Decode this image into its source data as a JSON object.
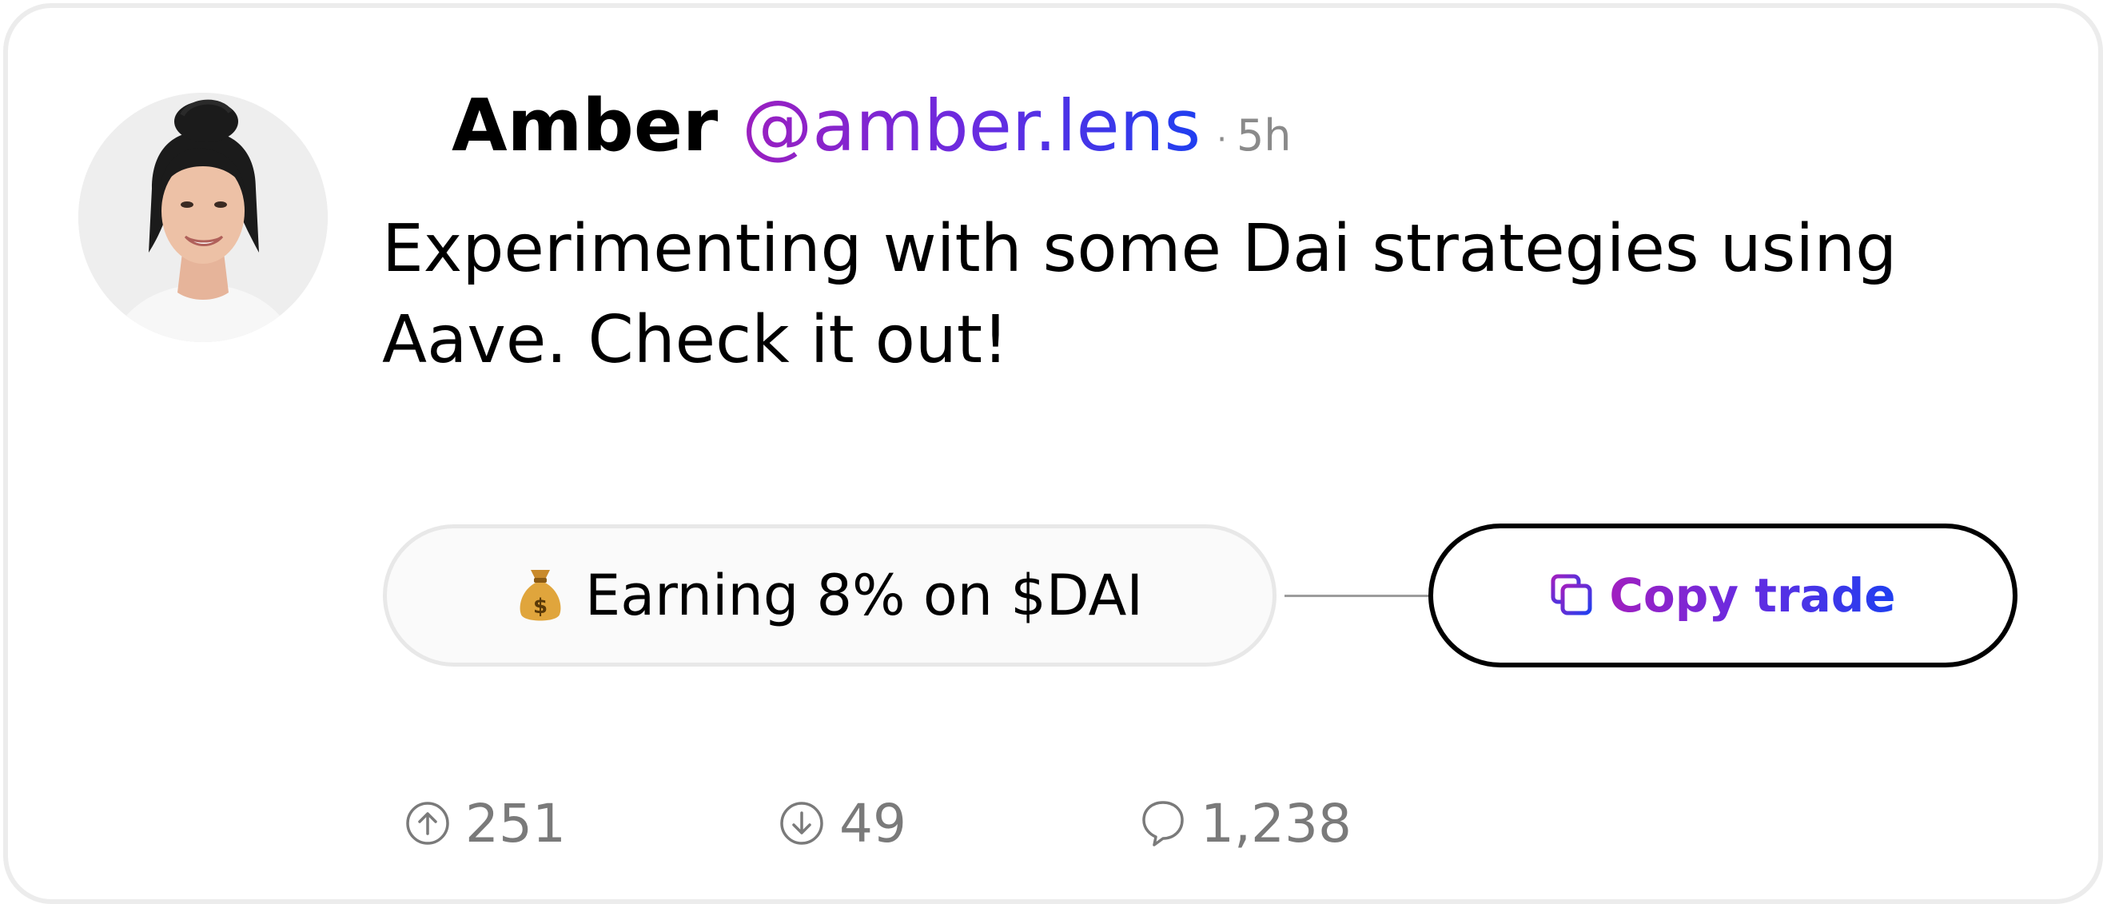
{
  "post": {
    "author": {
      "name": "Amber",
      "handle": "@amber.lens",
      "avatar_icon": "avatar-photo"
    },
    "separator": "·",
    "time": "5h",
    "text": "Experimenting with some Dai strategies using Aave. Check it out!",
    "strategy": {
      "emoji": "money-bag-icon",
      "label": "Earning 8% on $DAI"
    },
    "copy_button": {
      "icon": "copy-icon",
      "label": "Copy trade"
    },
    "stats": {
      "upvotes": "251",
      "downvotes": "49",
      "comments": "1,238"
    }
  },
  "colors": {
    "gradient_start": "#9b1fbf",
    "gradient_end": "#1f3ff0",
    "muted_text": "#7a7a7a",
    "card_border": "#ececec"
  }
}
